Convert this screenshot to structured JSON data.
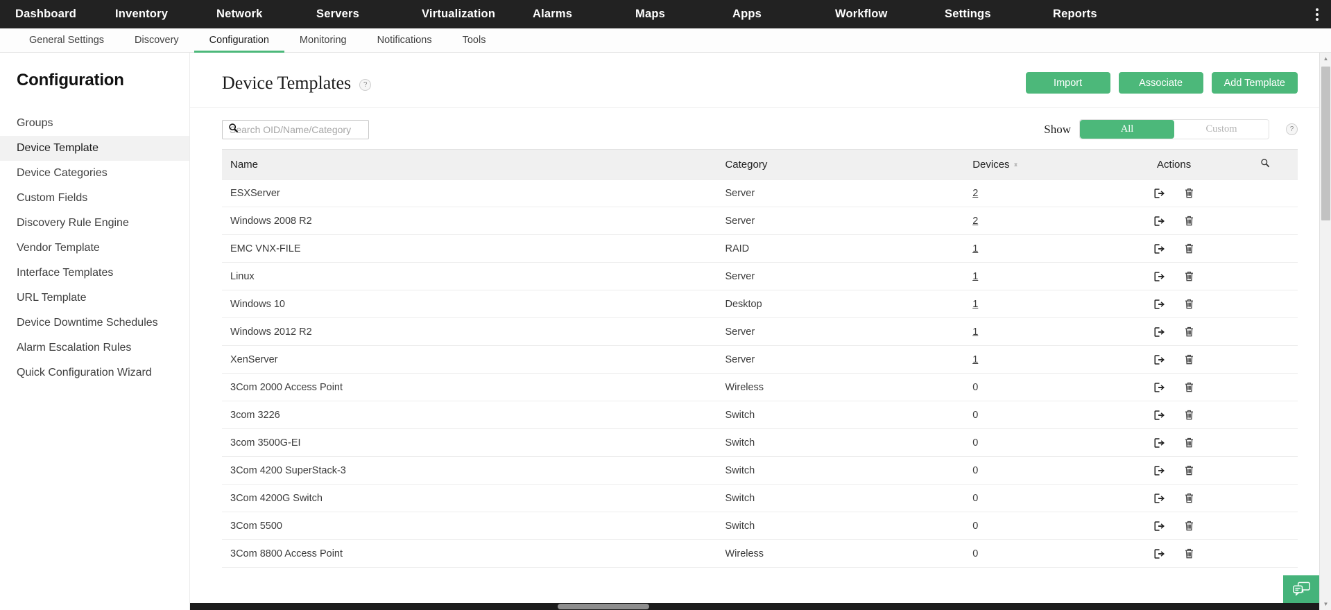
{
  "topnav": {
    "items": [
      {
        "label": "Dashboard"
      },
      {
        "label": "Inventory"
      },
      {
        "label": "Network"
      },
      {
        "label": "Servers"
      },
      {
        "label": "Virtualization"
      },
      {
        "label": "Alarms"
      },
      {
        "label": "Maps"
      },
      {
        "label": "Apps"
      },
      {
        "label": "Workflow"
      },
      {
        "label": "Settings"
      },
      {
        "label": "Reports"
      }
    ],
    "overflow_icon": "kebab-menu-icon"
  },
  "subnav": {
    "items": [
      {
        "label": "General Settings",
        "active": false
      },
      {
        "label": "Discovery",
        "active": false
      },
      {
        "label": "Configuration",
        "active": true
      },
      {
        "label": "Monitoring",
        "active": false
      },
      {
        "label": "Notifications",
        "active": false
      },
      {
        "label": "Tools",
        "active": false
      }
    ]
  },
  "sidebar": {
    "title": "Configuration",
    "items": [
      {
        "label": "Groups",
        "active": false
      },
      {
        "label": "Device Template",
        "active": true
      },
      {
        "label": "Device Categories",
        "active": false
      },
      {
        "label": "Custom Fields",
        "active": false
      },
      {
        "label": "Discovery Rule Engine",
        "active": false
      },
      {
        "label": "Vendor Template",
        "active": false
      },
      {
        "label": "Interface Templates",
        "active": false
      },
      {
        "label": "URL Template",
        "active": false
      },
      {
        "label": "Device Downtime Schedules",
        "active": false
      },
      {
        "label": "Alarm Escalation Rules",
        "active": false
      },
      {
        "label": "Quick Configuration Wizard",
        "active": false
      }
    ]
  },
  "page": {
    "title": "Device Templates",
    "help_badge": "?",
    "buttons": {
      "import": "Import",
      "associate": "Associate",
      "add_template": "Add Template"
    }
  },
  "search": {
    "value": "",
    "placeholder": "Search OID/Name/Category",
    "icon": "search-icon"
  },
  "show_filter": {
    "label": "Show",
    "options": [
      "All",
      "Custom"
    ],
    "selected": "All",
    "help_badge": "?"
  },
  "table": {
    "columns": [
      "Name",
      "Category",
      "Devices",
      "Actions"
    ],
    "sort_column": "Devices",
    "search_icon": "search-icon",
    "rows": [
      {
        "name": "ESXServer",
        "category": "Server",
        "devices": "2",
        "linked": true
      },
      {
        "name": "Windows 2008 R2",
        "category": "Server",
        "devices": "2",
        "linked": true
      },
      {
        "name": "EMC VNX-FILE",
        "category": "RAID",
        "devices": "1",
        "linked": true
      },
      {
        "name": "Linux",
        "category": "Server",
        "devices": "1",
        "linked": true
      },
      {
        "name": "Windows 10",
        "category": "Desktop",
        "devices": "1",
        "linked": true
      },
      {
        "name": "Windows 2012 R2",
        "category": "Server",
        "devices": "1",
        "linked": true
      },
      {
        "name": "XenServer",
        "category": "Server",
        "devices": "1",
        "linked": true
      },
      {
        "name": "3Com 2000 Access Point",
        "category": "Wireless",
        "devices": "0",
        "linked": false
      },
      {
        "name": "3com 3226",
        "category": "Switch",
        "devices": "0",
        "linked": false
      },
      {
        "name": "3com 3500G-EI",
        "category": "Switch",
        "devices": "0",
        "linked": false
      },
      {
        "name": "3Com 4200 SuperStack-3",
        "category": "Switch",
        "devices": "0",
        "linked": false
      },
      {
        "name": "3Com 4200G Switch",
        "category": "Switch",
        "devices": "0",
        "linked": false
      },
      {
        "name": "3Com 5500",
        "category": "Switch",
        "devices": "0",
        "linked": false
      },
      {
        "name": "3Com 8800 Access Point",
        "category": "Wireless",
        "devices": "0",
        "linked": false
      }
    ],
    "row_actions": [
      {
        "icon": "export-icon",
        "name": "associate-devices-action"
      },
      {
        "icon": "trash-icon",
        "name": "delete-template-action"
      }
    ]
  },
  "chat_fab": {
    "icon": "chat-bubbles-icon"
  }
}
